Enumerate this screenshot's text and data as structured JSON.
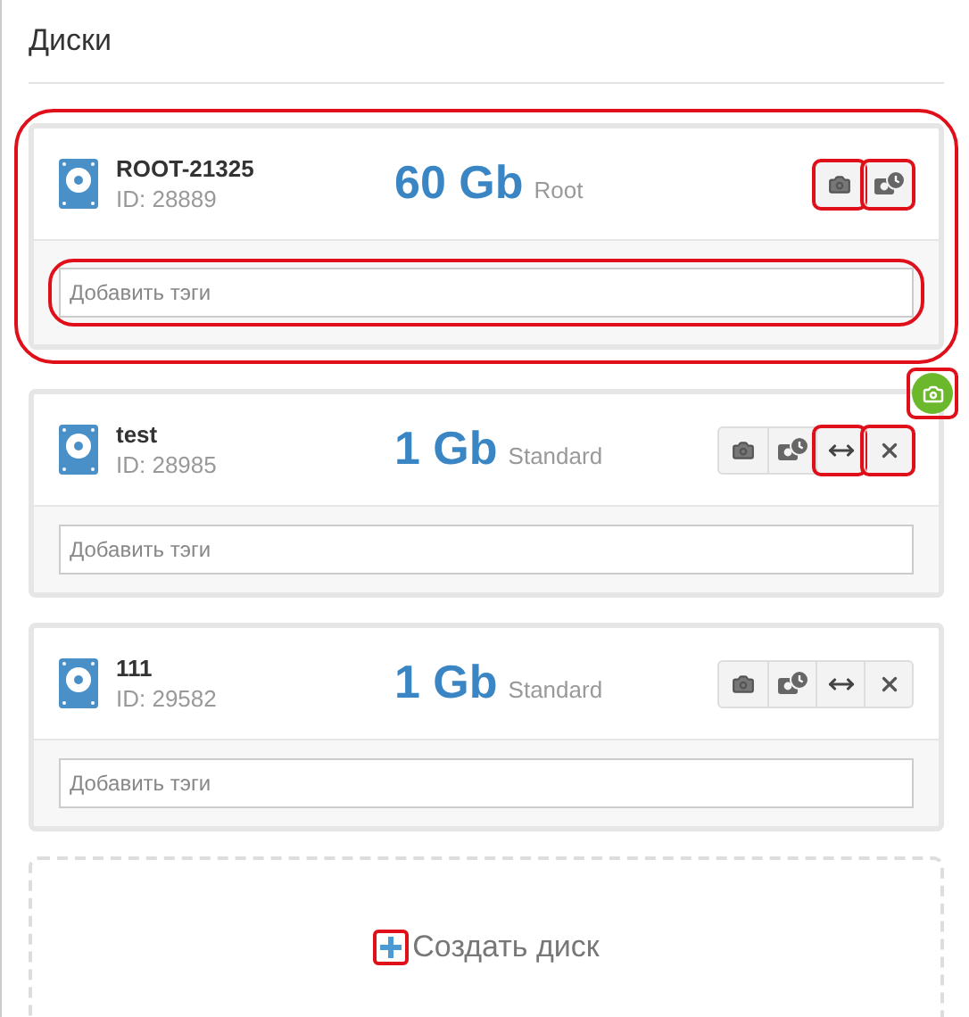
{
  "title": "Диски",
  "disks": [
    {
      "name": "ROOT-21325",
      "id": "ID: 28889",
      "size": "60 Gb",
      "type": "Root",
      "highlighted": true,
      "snapshot_badge": false,
      "tags": {
        "placeholder": "Добавить тэги",
        "highlighted": true
      },
      "actions": [
        {
          "kind": "snapshot",
          "highlighted": true
        },
        {
          "kind": "schedule",
          "highlighted": true
        }
      ]
    },
    {
      "name": "test",
      "id": "ID: 28985",
      "size": "1 Gb",
      "type": "Standard",
      "highlighted": false,
      "snapshot_badge": true,
      "tags": {
        "placeholder": "Добавить тэги",
        "highlighted": false
      },
      "actions": [
        {
          "kind": "snapshot",
          "highlighted": false
        },
        {
          "kind": "schedule",
          "highlighted": false
        },
        {
          "kind": "resize",
          "highlighted": true
        },
        {
          "kind": "delete",
          "highlighted": true
        }
      ]
    },
    {
      "name": "111",
      "id": "ID: 29582",
      "size": "1 Gb",
      "type": "Standard",
      "highlighted": false,
      "snapshot_badge": false,
      "tags": {
        "placeholder": "Добавить тэги",
        "highlighted": false
      },
      "actions": [
        {
          "kind": "snapshot",
          "highlighted": false
        },
        {
          "kind": "schedule",
          "highlighted": false
        },
        {
          "kind": "resize",
          "highlighted": false
        },
        {
          "kind": "delete",
          "highlighted": false
        }
      ]
    }
  ],
  "create": {
    "label": "Создать диск",
    "icon_highlighted": true
  }
}
